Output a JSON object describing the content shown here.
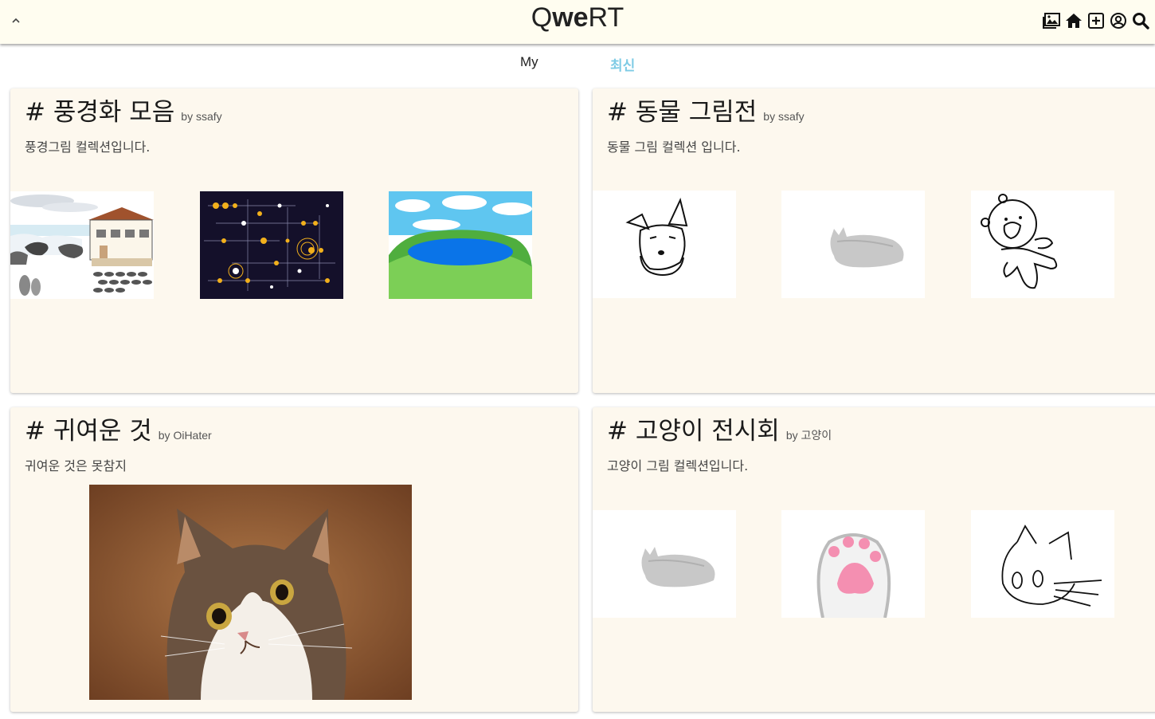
{
  "header": {
    "logo_part1": "Q",
    "logo_part2": "we",
    "logo_part3": "RT",
    "icons": [
      "gallery-icon",
      "home-icon",
      "add-icon",
      "profile-icon",
      "search-icon"
    ]
  },
  "tabs": [
    {
      "label": "My",
      "active": false
    },
    {
      "label": "최신",
      "active": true
    }
  ],
  "colors": {
    "accent": "#7ecbe5",
    "card_bg": "#fdf8ee",
    "header_bg": "#fffdf0"
  },
  "collections": [
    {
      "title": "# 풍경화 모음",
      "by": "by ssafy",
      "description": "풍경그림 컬렉션입니다.",
      "images": [
        "seaside-house-painting",
        "star-map-painting",
        "lake-landscape-painting"
      ]
    },
    {
      "title": "# 동물 그림전",
      "by": "by ssafy",
      "description": "동물 그림 컬렉션 입니다.",
      "images": [
        "schnauzer-drawing",
        "gray-cat-sketch",
        "bear-character-drawing"
      ]
    },
    {
      "title": "# 귀여운 것",
      "by": "by OiHater",
      "description": "귀여운 것은 못참지",
      "images": [
        "cat-portrait-painting"
      ]
    },
    {
      "title": "# 고양이 전시회",
      "by": "by 고양이",
      "description": "고양이 그림 컬렉션입니다.",
      "images": [
        "gray-cat-sketch",
        "cat-paw-drawing",
        "cat-face-line-drawing"
      ]
    }
  ]
}
